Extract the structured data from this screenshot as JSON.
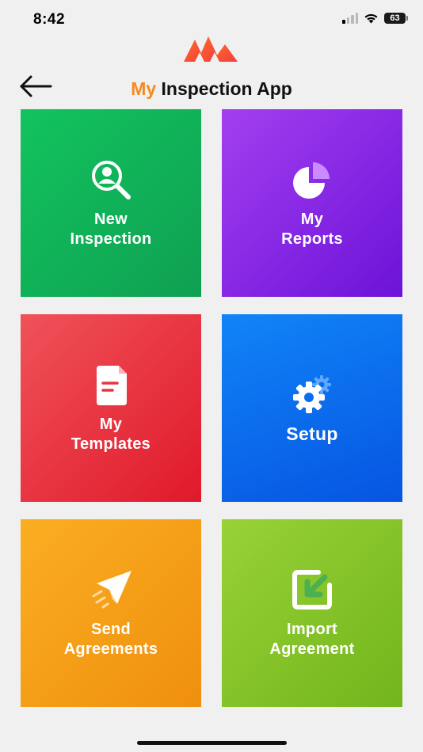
{
  "status_bar": {
    "time": "8:42",
    "battery": "63",
    "icons": [
      "cellular-signal-icon",
      "wifi-icon",
      "battery-icon"
    ]
  },
  "header": {
    "logo_icon": "mountain-logo-icon",
    "back_icon": "arrow-left-icon",
    "title_accent": "My",
    "title_rest": " Inspection App"
  },
  "tiles": [
    {
      "label": "New\nInspection",
      "icon": "search-person-icon",
      "color": "#12c35e"
    },
    {
      "label": "My\nReports",
      "icon": "pie-chart-icon",
      "color": "#8a2be2"
    },
    {
      "label": "My\nTemplates",
      "icon": "document-icon",
      "color": "#ea3440"
    },
    {
      "label": "Setup",
      "icon": "gears-icon",
      "color": "#0a6cf0"
    },
    {
      "label": "Send\nAgreements",
      "icon": "paper-plane-icon",
      "color": "#f7a01a"
    },
    {
      "label": "Import\nAgreement",
      "icon": "import-arrow-icon",
      "color": "#85c42a"
    }
  ],
  "colors": {
    "accent": "#f58a1f",
    "background": "#f0f0f1"
  }
}
